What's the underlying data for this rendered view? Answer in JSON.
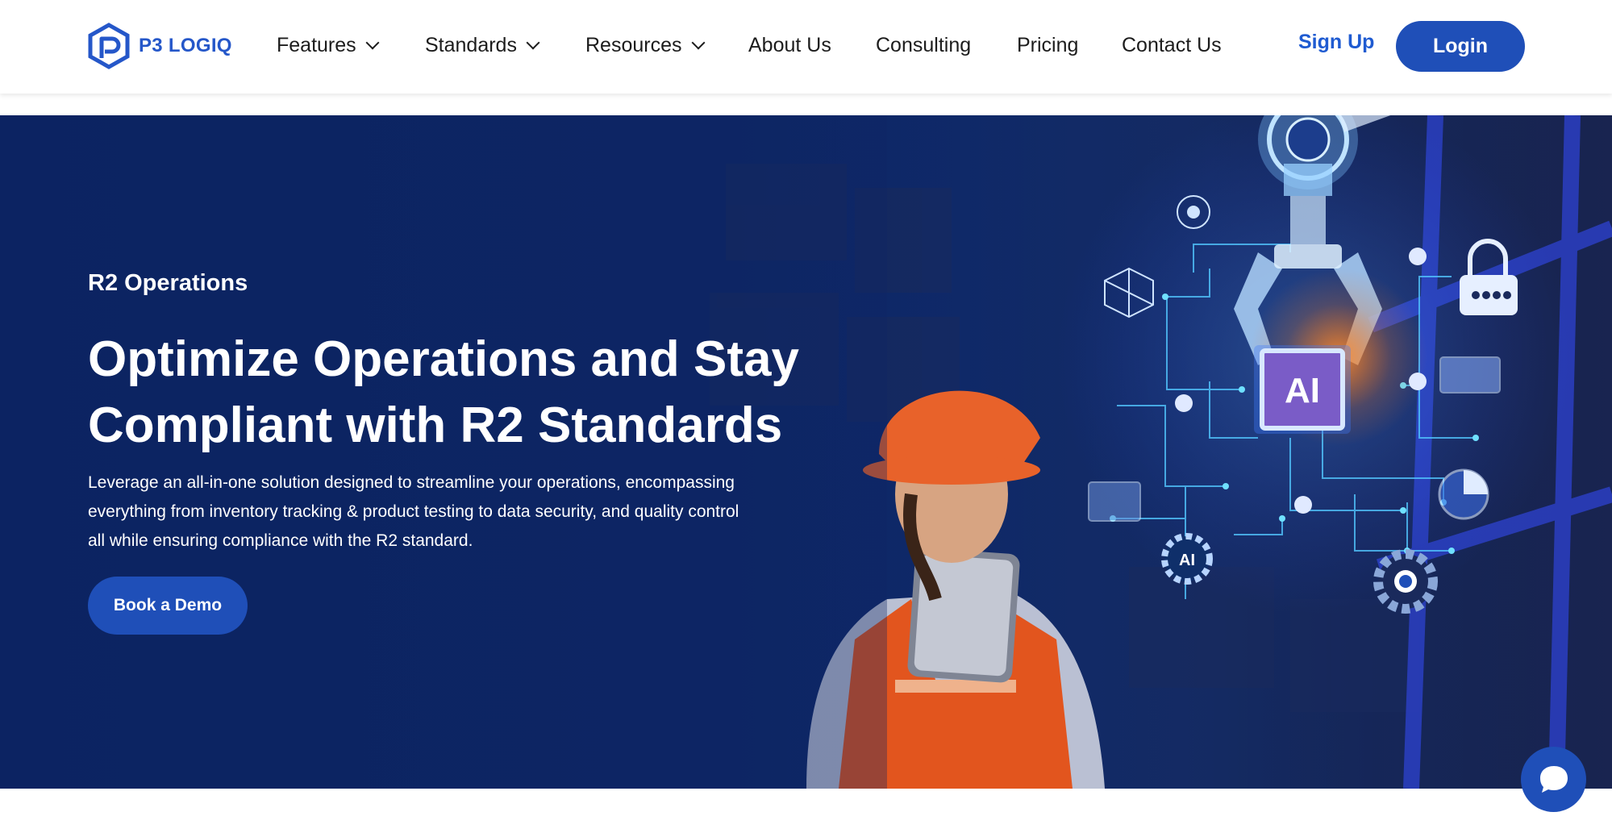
{
  "brand": {
    "name": "P3 LOGIQ",
    "color": "#2557c9"
  },
  "nav": {
    "items": [
      {
        "label": "Features",
        "dropdown": true
      },
      {
        "label": "Standards",
        "dropdown": true
      },
      {
        "label": "Resources",
        "dropdown": true
      },
      {
        "label": "About Us",
        "dropdown": false
      },
      {
        "label": "Consulting",
        "dropdown": false
      },
      {
        "label": "Pricing",
        "dropdown": false
      },
      {
        "label": "Contact Us",
        "dropdown": false
      }
    ],
    "signup_label": "Sign Up",
    "login_label": "Login"
  },
  "hero": {
    "eyebrow": "R2 Operations",
    "headline": "Optimize Operations and Stay Compliant with R2 Standards",
    "description": "Leverage an all-in-one solution designed to streamline your operations, encompassing everything from inventory tracking & product testing to data security, and quality control all while ensuring compliance with the R2 standard.",
    "cta_label": "Book a Demo",
    "art_chip_label": "AI",
    "art_gear_label": "AI"
  },
  "colors": {
    "accent": "#1f4fb8",
    "hero_bg": "#0c2361",
    "text_dark": "#1c1c1c"
  },
  "icons": {
    "chat": "chat-bubble-icon",
    "logo": "p3-logo-icon"
  }
}
